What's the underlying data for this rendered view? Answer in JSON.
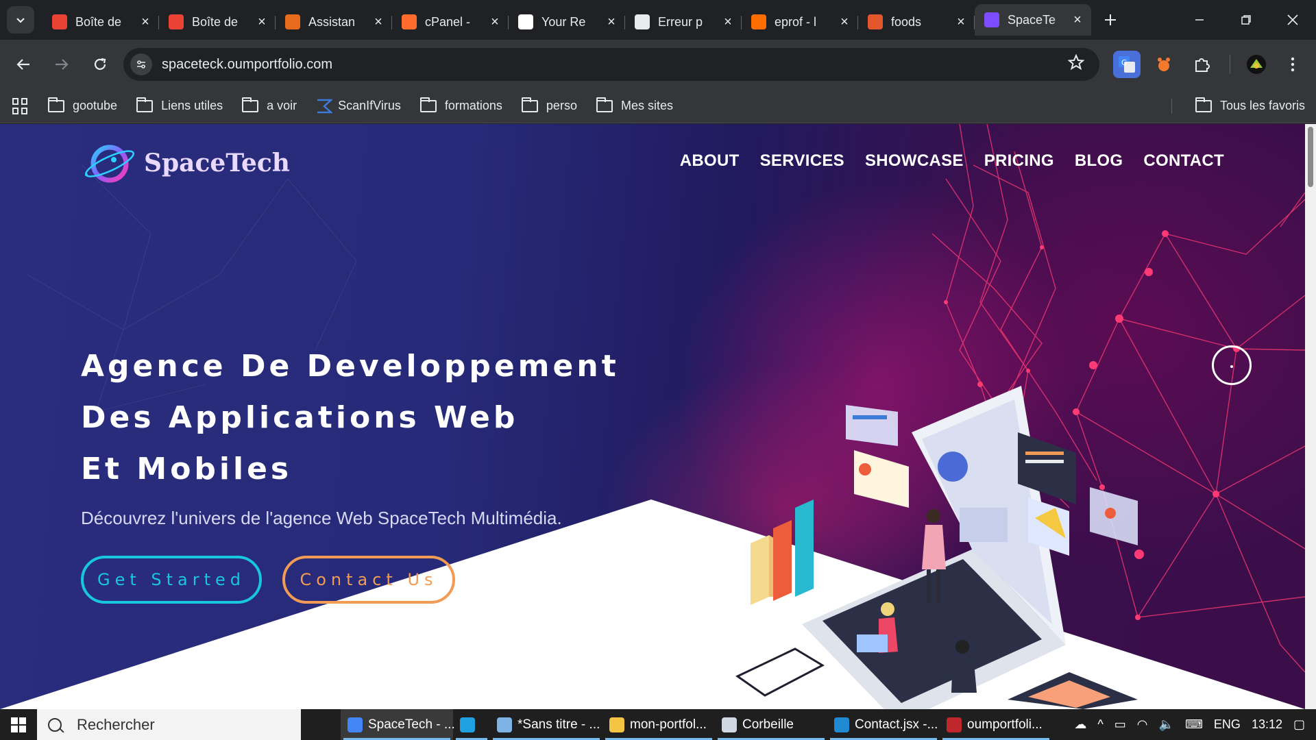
{
  "browser": {
    "tabs": [
      {
        "title": "Boîte de",
        "favicon": "gmail-icon",
        "color": "#ea4335",
        "active": false
      },
      {
        "title": "Boîte de",
        "favicon": "gmail-icon",
        "color": "#ea4335",
        "active": false
      },
      {
        "title": "Assistan",
        "favicon": "assistant-icon",
        "color": "#e86a1c",
        "active": false
      },
      {
        "title": "cPanel -",
        "favicon": "cpanel-icon",
        "color": "#ff6c2c",
        "active": false
      },
      {
        "title": "Your Re",
        "favicon": "github-icon",
        "color": "#ffffff",
        "active": false
      },
      {
        "title": "Erreur p",
        "favicon": "openai-icon",
        "color": "#e8eaed",
        "active": false
      },
      {
        "title": "eprof - l",
        "favicon": "flame-icon",
        "color": "#ff6d00",
        "active": false
      },
      {
        "title": "foods",
        "favicon": "food-icon",
        "color": "#e4572e",
        "active": false
      },
      {
        "title": "SpaceTe",
        "favicon": "spacetech-icon",
        "color": "#7b4dff",
        "active": true
      }
    ],
    "url": "spaceteck.oumportfolio.com",
    "bookmarks": [
      "gootube",
      "Liens utiles",
      "a voir",
      "ScanIfVirus",
      "formations",
      "perso",
      "Mes sites"
    ],
    "all_bookmarks": "Tous les favoris"
  },
  "site": {
    "logo": "SpaceTech",
    "nav": [
      "ABOUT",
      "SERVICES",
      "SHOWCASE",
      "PRICING",
      "BLOG",
      "CONTACT"
    ],
    "hero_title": [
      "Agence De Developpement",
      "Des Applications Web",
      "Et Mobiles"
    ],
    "hero_subtitle": "Découvrez l'univers de l'agence Web SpaceTech Multimédia.",
    "primary_button": "Get Started",
    "secondary_button": "Contact Us",
    "colors": {
      "primary": "#18c6e0",
      "secondary": "#f29b54"
    }
  },
  "taskbar": {
    "search_placeholder": "Rechercher",
    "items": [
      {
        "label": "SpaceTech - ...",
        "icon": "chrome-icon",
        "color": "#4285f4"
      },
      {
        "label": "",
        "icon": "edge-icon",
        "color": "#1fa0e0"
      },
      {
        "label": "*Sans titre - ...",
        "icon": "notepad-icon",
        "color": "#7fb3e6"
      },
      {
        "label": "mon-portfol...",
        "icon": "folder-icon",
        "color": "#f4c542"
      },
      {
        "label": "Corbeille",
        "icon": "recycle-bin-icon",
        "color": "#cfd8e3"
      },
      {
        "label": "Contact.jsx -...",
        "icon": "vscode-icon",
        "color": "#1f8ad2"
      },
      {
        "label": "oumportfoli...",
        "icon": "filezilla-icon",
        "color": "#c0272d"
      }
    ],
    "language": "ENG",
    "time": "13:12"
  }
}
